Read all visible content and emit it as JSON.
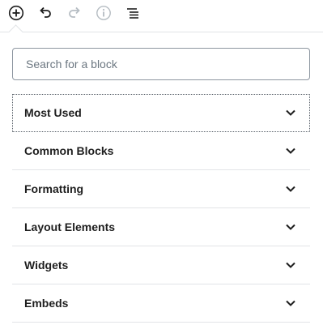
{
  "toolbar": {
    "icons": [
      "plus-circle-icon",
      "undo-icon",
      "redo-icon",
      "info-icon",
      "list-icon"
    ]
  },
  "search": {
    "placeholder": "Search for a block",
    "value": ""
  },
  "panels": [
    {
      "title": "Most Used",
      "icon": "chevron-down-icon"
    },
    {
      "title": "Common Blocks",
      "icon": "chevron-down-icon"
    },
    {
      "title": "Formatting",
      "icon": "chevron-down-icon"
    },
    {
      "title": "Layout Elements",
      "icon": "chevron-down-icon"
    },
    {
      "title": "Widgets",
      "icon": "chevron-down-icon"
    },
    {
      "title": "Embeds",
      "icon": "chevron-down-icon"
    }
  ],
  "colors": {
    "icon_active": "#1e1e1e",
    "icon_disabled": "#b5bcc2",
    "border": "#e2e4e7",
    "input_border": "#8d96a0"
  }
}
